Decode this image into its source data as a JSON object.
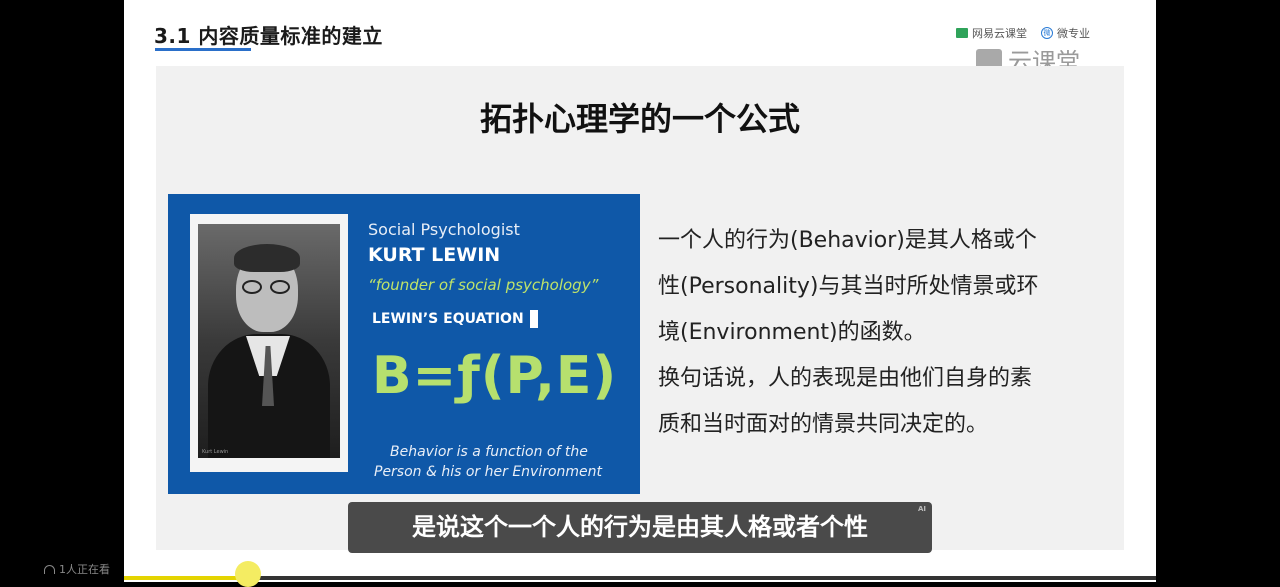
{
  "slide": {
    "section_title": "3.1 内容质量标准的建立",
    "brand_small_1": "网易云课堂",
    "brand_small_2": "微专业",
    "brand_small_2_icon_text": "微",
    "brand_big": "云课堂",
    "heading": "拓扑心理学的一个公式"
  },
  "poster": {
    "role": "Social Psychologist",
    "name": "KURT LEWIN",
    "quote": "“founder of social psychology”",
    "equation_label": "LEWIN’S EQUATION",
    "formula": "B=ƒ(P,E)",
    "desc_line1": "Behavior is a function of the",
    "desc_line2": "Person & his or her Environment",
    "photo_caption": "Kurt Lewin"
  },
  "body_lines": [
    "一个人的行为(Behavior)是其人格或个",
    "性(Personality)与其当时所处情景或环",
    "境(Environment)的函数。",
    "换句话说，人的表现是由他们自身的素",
    "质和当时面对的情景共同决定的。"
  ],
  "subtitle": {
    "text": "是说这个一个人的行为是由其人格或者个性",
    "badge": "AI"
  },
  "player": {
    "viewers": "1人正在看",
    "progress": 0.12,
    "accent_color": "#e4d400"
  }
}
